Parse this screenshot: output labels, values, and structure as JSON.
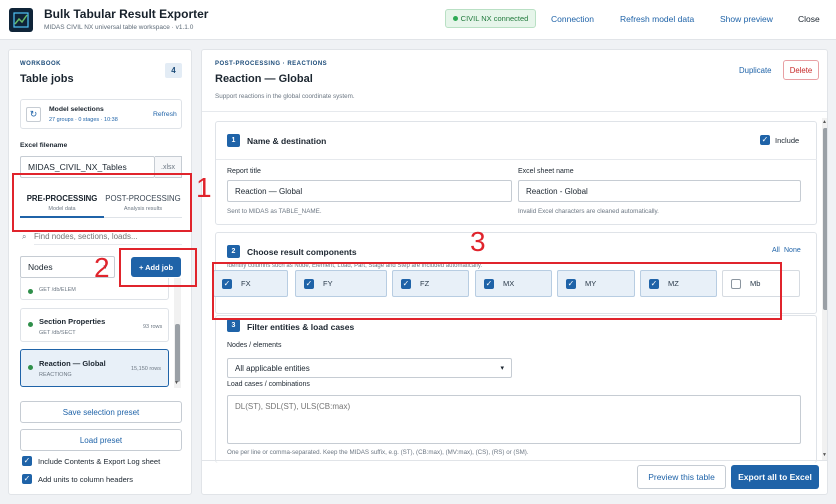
{
  "header": {
    "title": "Bulk Tabular Result Exporter",
    "subtitle": "MIDAS CIVIL NX universal table workspace · v1.1.0",
    "status": "CIVIL NX connected",
    "connection": "Connection",
    "refresh": "Refresh model data",
    "show_preview": "Show preview",
    "close": "Close"
  },
  "sidebar": {
    "eyebrow": "WORKBOOK",
    "title": "Table jobs",
    "count": "4",
    "model": {
      "title": "Model selections",
      "meta": "27 groups · 0 stages · 10:38",
      "refresh": "Refresh"
    },
    "excel_label": "Excel filename",
    "excel_value": "MIDAS_CIVIL_NX_Tables",
    "excel_ext": ".xlsx",
    "tabs": [
      {
        "label": "PRE-PROCESSING",
        "sub": "Model data"
      },
      {
        "label": "POST-PROCESSING",
        "sub": "Analysis results"
      }
    ],
    "search_placeholder": "Find nodes, sections, loads...",
    "type_select": "Nodes",
    "add_job": "+ Add job",
    "jobs": [
      {
        "title": "",
        "sub": "GET /db/ELEM",
        "rows": ""
      },
      {
        "title": "Section Properties",
        "sub": "GET /db/SECT",
        "rows": "93 rows"
      },
      {
        "title": "Reaction — Global",
        "sub": "REACTIONG",
        "rows": "15,150 rows"
      }
    ],
    "save_preset": "Save selection preset",
    "load_preset": "Load preset",
    "options": [
      {
        "label": "Include Contents & Export Log sheet"
      },
      {
        "label": "Add units to column headers"
      }
    ]
  },
  "main": {
    "eyebrow": "POST-PROCESSING · REACTIONS",
    "title": "Reaction — Global",
    "desc": "Support reactions in the global coordinate system.",
    "duplicate": "Duplicate",
    "delete": "Delete",
    "s1": {
      "num": "1",
      "title": "Name & destination",
      "include": "Include",
      "report_label": "Report title",
      "report_value": "Reaction — Global",
      "report_hint": "Sent to MIDAS as TABLE_NAME.",
      "sheet_label": "Excel sheet name",
      "sheet_value": "Reaction - Global",
      "sheet_hint": "Invalid Excel characters are cleaned automatically."
    },
    "s2": {
      "num": "2",
      "title": "Choose result components",
      "all": "All",
      "none": "None",
      "hint": "Identify columns such as Node, Element, Load, Part, Stage and Step are included automatically.",
      "components": [
        {
          "label": "FX",
          "checked": true
        },
        {
          "label": "FY",
          "checked": true
        },
        {
          "label": "FZ",
          "checked": true
        },
        {
          "label": "MX",
          "checked": true
        },
        {
          "label": "MY",
          "checked": true
        },
        {
          "label": "MZ",
          "checked": true
        },
        {
          "label": "Mb",
          "checked": false
        }
      ]
    },
    "s3": {
      "num": "3",
      "title": "Filter entities & load cases",
      "nodes_label": "Nodes / elements",
      "nodes_value": "All applicable entities",
      "load_label": "Load cases / combinations",
      "load_placeholder": "DL(ST), SDL(ST), ULS(CB:max)",
      "hint": "One per line or comma-separated. Keep the MIDAS suffix, e.g. (ST), (CB:max), (MV:max), (CS), (RS) or (SM)."
    },
    "preview": "Preview this table",
    "export": "Export all to Excel"
  },
  "annotations": [
    "1",
    "2",
    "3"
  ],
  "colors": {
    "accent": "#1f63a8",
    "annotation": "#e0242c",
    "success": "#217a3c"
  }
}
